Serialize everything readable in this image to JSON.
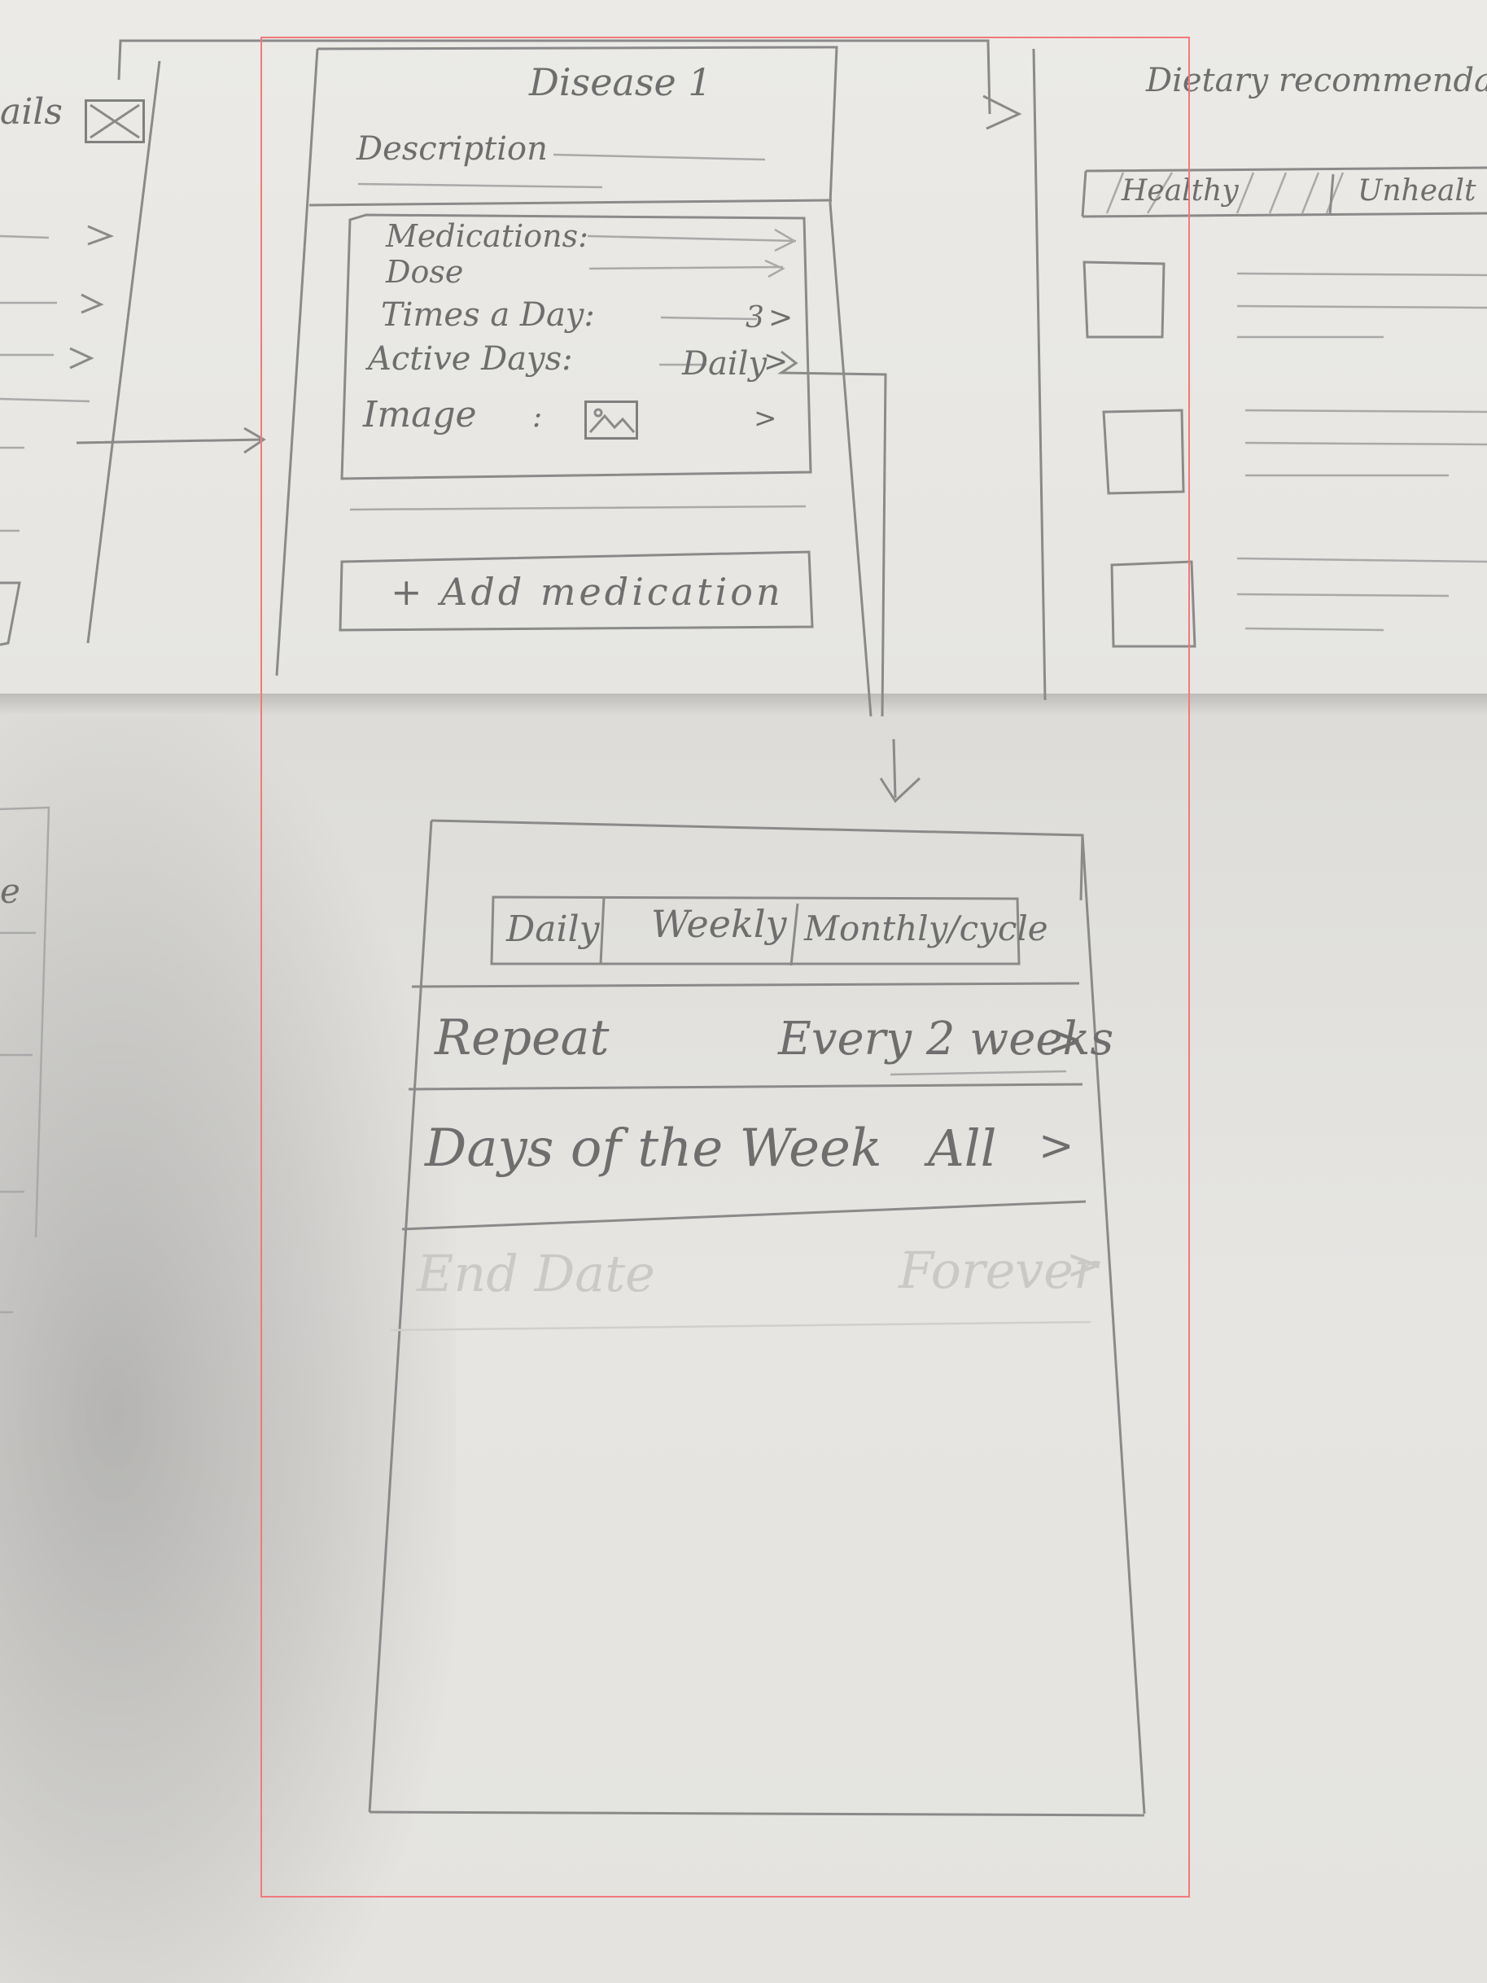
{
  "left_screen": {
    "partial_title": "ails",
    "close_icon": "x-box-icon",
    "partial_row": "e"
  },
  "disease_screen": {
    "title": "Disease 1",
    "description_label": "Description",
    "medication_card": {
      "medications_label": "Medications:",
      "dose_label": "Dose",
      "times_label": "Times a Day:",
      "times_value": "3",
      "active_days_label": "Active Days:",
      "active_days_value": "Daily",
      "image_label": "Image",
      "image_icon": "image-icon",
      "chevron": ">"
    },
    "add_button_label": "+ Add medication"
  },
  "diet_screen": {
    "title": "Dietary recommendat",
    "tab_healthy": "Healthy",
    "tab_unhealthy": "Unhealt"
  },
  "schedule_screen": {
    "tabs": [
      "Daily",
      "Weekly",
      "Monthly/cycle"
    ],
    "repeat_label": "Repeat",
    "repeat_value": "Every 2 weeks",
    "days_label": "Days of the Week",
    "days_value": "All",
    "end_date_label": "End Date",
    "end_date_value": "Forever",
    "chevron": ">"
  }
}
